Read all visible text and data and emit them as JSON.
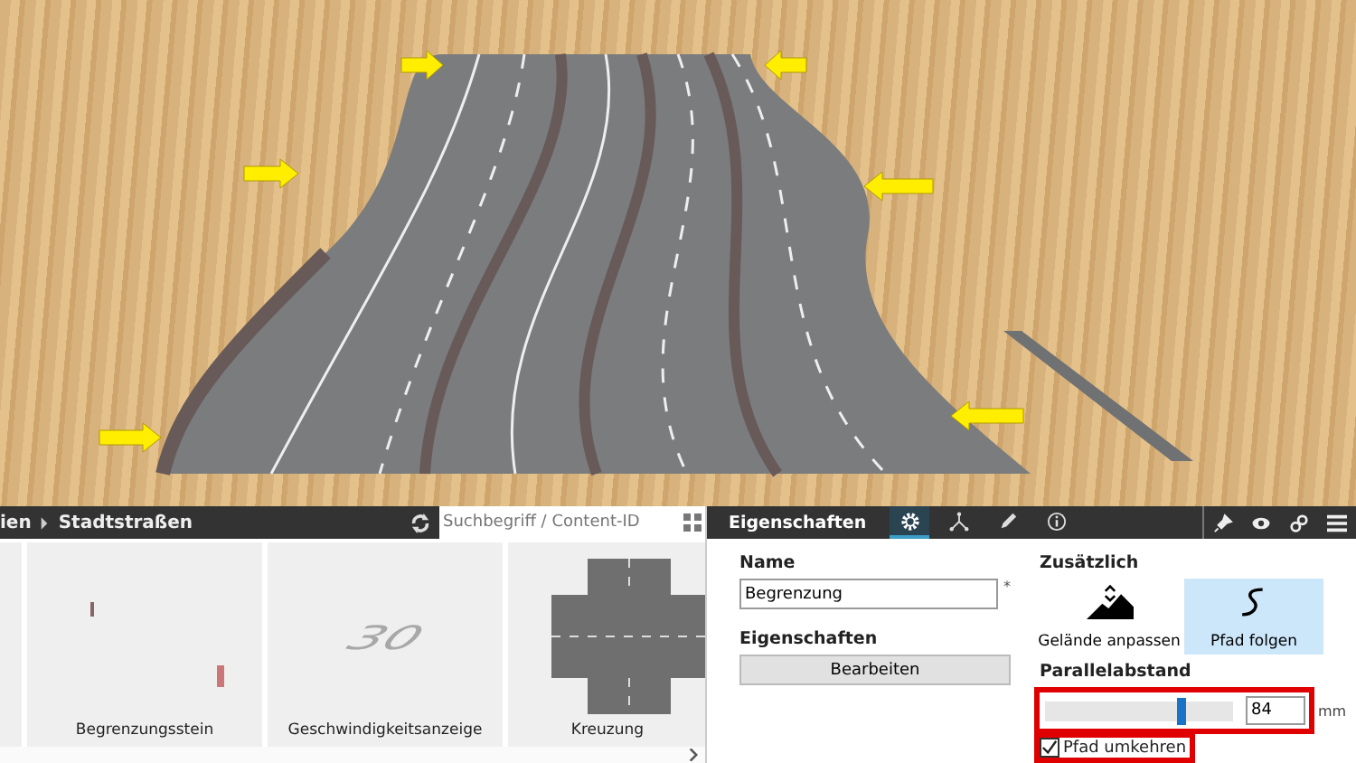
{
  "catalog": {
    "breadcrumb": [
      "ien",
      "Stadtstraßen"
    ],
    "search": {
      "placeholder": "Suchbegriff / Content-ID"
    },
    "items": [
      {
        "kind": "partial"
      },
      {
        "kind": "stones",
        "label": "Begrenzungsstein"
      },
      {
        "kind": "speed",
        "marking": "30",
        "label": "Geschwindigkeitsanzeige"
      },
      {
        "kind": "crossing",
        "label": "Kreuzung"
      }
    ]
  },
  "properties": {
    "title": "Eigenschaften",
    "tabs": [
      {
        "kind": "gear",
        "selected": true
      },
      {
        "kind": "nodes",
        "selected": false
      },
      {
        "kind": "pen",
        "selected": false
      },
      {
        "kind": "info",
        "selected": false
      }
    ],
    "name_label": "Name",
    "name_value": "Begrenzung",
    "required_mark": "*",
    "section_label": "Eigenschaften",
    "edit_button": "Bearbeiten",
    "extra_label": "Zusätzlich",
    "options": [
      {
        "kind": "terrain",
        "label": "Gelände anpassen",
        "selected": false
      },
      {
        "kind": "path",
        "label": "Pfad folgen",
        "selected": true
      }
    ],
    "offset_label": "Parallelabstand",
    "offset": {
      "level": 0.73,
      "value": "84",
      "unit": "mm",
      "highlighted": true
    },
    "reverse": {
      "label": "Pfad umkehren",
      "checked": true,
      "highlighted": true
    }
  }
}
